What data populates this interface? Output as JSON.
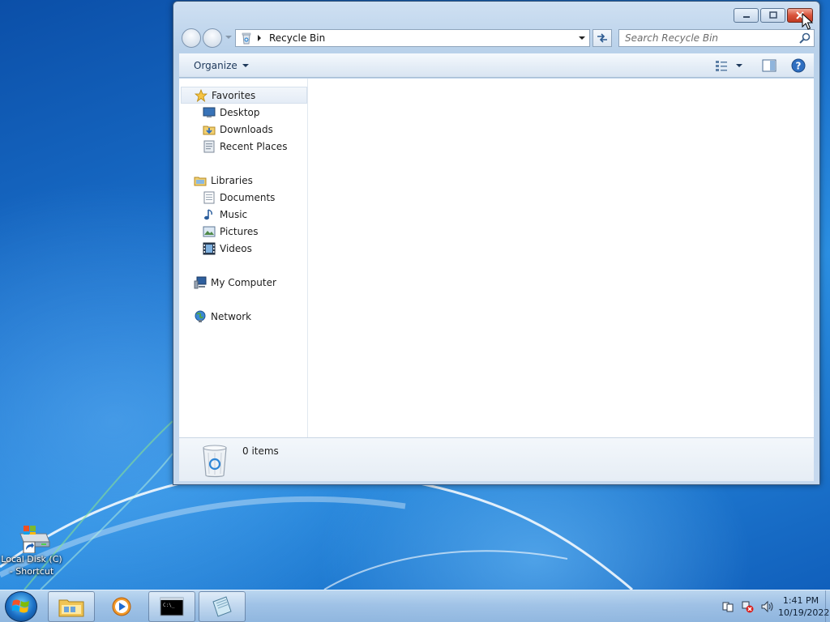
{
  "window": {
    "title": "Recycle Bin",
    "address": {
      "location": "Recycle Bin"
    },
    "search": {
      "placeholder": "Search Recycle Bin"
    },
    "toolbar": {
      "organize_label": "Organize"
    },
    "nav_pane": {
      "favorites": {
        "label": "Favorites",
        "items": [
          {
            "label": "Desktop",
            "icon": "desktop-icon"
          },
          {
            "label": "Downloads",
            "icon": "downloads-icon"
          },
          {
            "label": "Recent Places",
            "icon": "recent-places-icon"
          }
        ]
      },
      "libraries": {
        "label": "Libraries",
        "items": [
          {
            "label": "Documents",
            "icon": "documents-icon"
          },
          {
            "label": "Music",
            "icon": "music-icon"
          },
          {
            "label": "Pictures",
            "icon": "pictures-icon"
          },
          {
            "label": "Videos",
            "icon": "videos-icon"
          }
        ]
      },
      "computer": {
        "label": "My Computer"
      },
      "network": {
        "label": "Network"
      }
    },
    "details": {
      "item_count": "0 items"
    }
  },
  "desktop": {
    "icons": [
      {
        "label": "Local Disk (C) - Shortcut",
        "icon": "drive-shortcut-icon"
      }
    ]
  },
  "taskbar": {
    "buttons": [
      {
        "name": "windows-explorer",
        "icon": "folder-icon"
      },
      {
        "name": "media-player",
        "icon": "media-player-icon"
      },
      {
        "name": "command-prompt",
        "icon": "cmd-icon"
      },
      {
        "name": "notepad",
        "icon": "notepad-icon"
      }
    ],
    "clock": {
      "time": "1:41 PM",
      "date": "10/19/2022"
    }
  },
  "colors": {
    "close_button": "#d9523a",
    "desktop": "#1c74cf",
    "address_text": "#111111"
  }
}
